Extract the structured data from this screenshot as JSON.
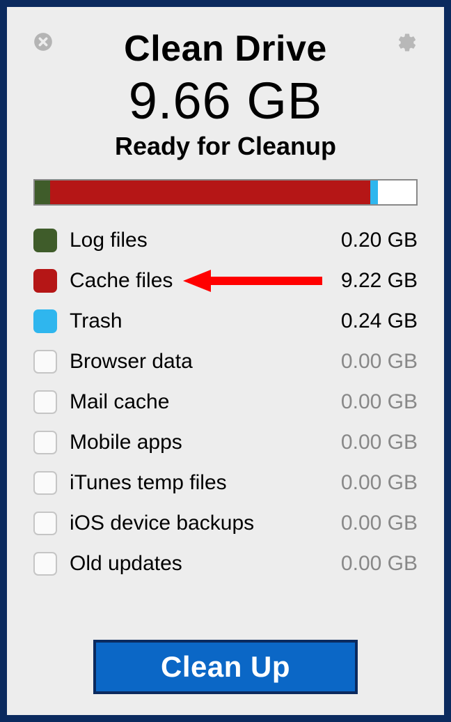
{
  "header": {
    "title": "Clean Drive",
    "total": "9.66 GB",
    "subtitle": "Ready for Cleanup"
  },
  "colors": {
    "log": "#3f5c2a",
    "cache": "#b51616",
    "trash": "#2fb6ee"
  },
  "bar_segments": [
    {
      "color": "#3f5c2a",
      "percent": 4
    },
    {
      "color": "#b51616",
      "percent": 84
    },
    {
      "color": "#2fb6ee",
      "percent": 2
    },
    {
      "color": "#ffffff",
      "percent": 10
    }
  ],
  "items": [
    {
      "label": "Log files",
      "size": "0.20 GB",
      "color": "#3f5c2a",
      "active": true
    },
    {
      "label": "Cache files",
      "size": "9.22 GB",
      "color": "#b51616",
      "active": true,
      "arrow": true
    },
    {
      "label": "Trash",
      "size": "0.24 GB",
      "color": "#2fb6ee",
      "active": true
    },
    {
      "label": "Browser data",
      "size": "0.00 GB",
      "color": "",
      "active": false
    },
    {
      "label": "Mail cache",
      "size": "0.00 GB",
      "color": "",
      "active": false
    },
    {
      "label": "Mobile apps",
      "size": "0.00 GB",
      "color": "",
      "active": false
    },
    {
      "label": "iTunes temp files",
      "size": "0.00 GB",
      "color": "",
      "active": false
    },
    {
      "label": "iOS device backups",
      "size": "0.00 GB",
      "color": "",
      "active": false
    },
    {
      "label": "Old updates",
      "size": "0.00 GB",
      "color": "",
      "active": false
    }
  ],
  "button": {
    "label": "Clean Up"
  }
}
